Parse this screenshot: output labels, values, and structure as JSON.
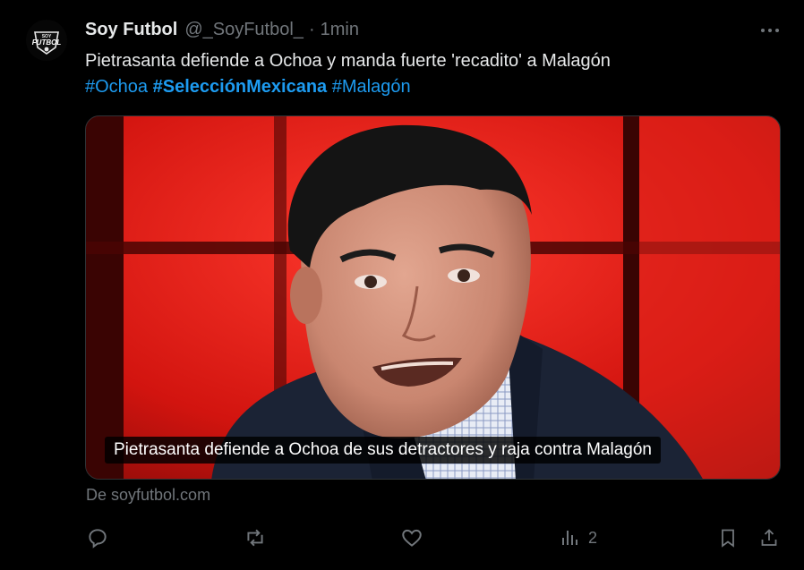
{
  "post": {
    "author_name": "Soy Futbol",
    "author_handle": "@_SoyFutbol_",
    "separator": "·",
    "time": "1min",
    "avatar_logo_text": "Soy Futbol",
    "text": "Pietrasanta defiende a Ochoa y manda fuerte 'recadito' a Malagón",
    "hashtags": [
      {
        "text": "#Ochoa",
        "bold": false
      },
      {
        "text": "#SelecciónMexicana",
        "bold": true
      },
      {
        "text": "#Malagón",
        "bold": false
      }
    ],
    "card": {
      "caption": "Pietrasanta defiende a Ochoa de sus detractores y raja contra Malagón"
    },
    "source": "De soyfutbol.com",
    "actions": {
      "views_count": "2"
    }
  },
  "colors": {
    "background": "#000000",
    "text": "#e7e9ea",
    "muted": "#71767b",
    "link": "#1d9bf0"
  },
  "icons": [
    "more-icon",
    "reply-icon",
    "retweet-icon",
    "like-icon",
    "views-icon",
    "bookmark-icon",
    "share-icon"
  ]
}
